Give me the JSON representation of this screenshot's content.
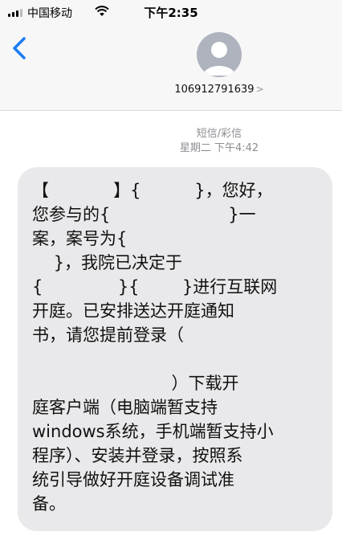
{
  "status_bar": {
    "carrier": "中国移动",
    "time": "下午2:35"
  },
  "contact": {
    "number": "106912791639",
    "chevron": ">"
  },
  "thread": {
    "service_label": "短信/彩信",
    "timestamp": "星期二 下午4:42"
  },
  "message": {
    "lines": [
      "【            】{          }，您好，",
      "您参与的{                      }一",
      "案，案号为{",
      "    }，我院已决定于",
      "{              }{        }进行互联网",
      "开庭。已安排送达开庭通知",
      "书，请您提前登录（",
      "",
      "                          ）下载开",
      "庭客户端（电脑端暂支持",
      "windows系统，手机端暂支持小",
      "程序）、安装并登录，按照系",
      "统引导做好开庭设备调试准",
      "备。"
    ]
  }
}
